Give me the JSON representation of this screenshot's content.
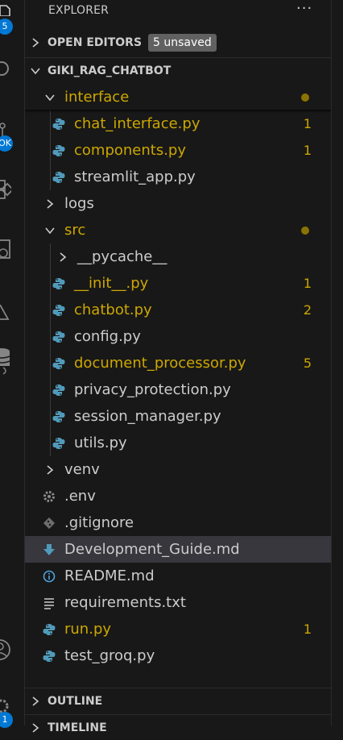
{
  "colors": {
    "modified": "#cca700",
    "normal": "#cccccc",
    "python_icon": "#519aba",
    "badge": "#0078d4",
    "selected_row": "#37373d",
    "md_icon": "#519aba",
    "info_icon": "#4fa3e0"
  },
  "activity_bar": {
    "badges": [
      "5",
      "OK",
      "1"
    ],
    "icons": [
      "files-icon",
      "search-icon",
      "source-control-icon",
      "extensions-icon",
      "remote-explorer-icon",
      "testing-icon",
      "database-icon",
      "account-icon",
      "settings-icon"
    ]
  },
  "explorer": {
    "title": "EXPLORER",
    "more_actions": "···",
    "open_editors": {
      "label": "OPEN EDITORS",
      "badge": "5 unsaved"
    },
    "project": {
      "label": "GIKI_RAG_CHATBOT"
    },
    "tree": [
      {
        "name": "interface",
        "kind": "folder",
        "open": true,
        "indent": 1,
        "status": "modified",
        "dot": true
      },
      {
        "name": "chat_interface.py",
        "kind": "py",
        "indent": 2,
        "status": "modified",
        "count": "1"
      },
      {
        "name": "components.py",
        "kind": "py",
        "indent": 2,
        "status": "modified",
        "count": "1"
      },
      {
        "name": "streamlit_app.py",
        "kind": "py",
        "indent": 2,
        "status": "normal"
      },
      {
        "name": "logs",
        "kind": "folder",
        "open": false,
        "indent": 1,
        "status": "normal"
      },
      {
        "name": "src",
        "kind": "folder",
        "open": true,
        "indent": 1,
        "status": "modified",
        "dot": true
      },
      {
        "name": "__pycache__",
        "kind": "folder",
        "open": false,
        "indent": 2,
        "status": "normal"
      },
      {
        "name": "__init__.py",
        "kind": "py",
        "indent": 2,
        "status": "modified",
        "count": "1"
      },
      {
        "name": "chatbot.py",
        "kind": "py",
        "indent": 2,
        "status": "modified",
        "count": "2"
      },
      {
        "name": "config.py",
        "kind": "py",
        "indent": 2,
        "status": "normal"
      },
      {
        "name": "document_processor.py",
        "kind": "py",
        "indent": 2,
        "status": "modified",
        "count": "5"
      },
      {
        "name": "privacy_protection.py",
        "kind": "py",
        "indent": 2,
        "status": "normal"
      },
      {
        "name": "session_manager.py",
        "kind": "py",
        "indent": 2,
        "status": "normal"
      },
      {
        "name": "utils.py",
        "kind": "py",
        "indent": 2,
        "status": "normal"
      },
      {
        "name": "venv",
        "kind": "folder",
        "open": false,
        "indent": 1,
        "status": "normal"
      },
      {
        "name": ".env",
        "kind": "env",
        "indent": 1,
        "status": "normal"
      },
      {
        "name": ".gitignore",
        "kind": "git",
        "indent": 1,
        "status": "normal"
      },
      {
        "name": "Development_Guide.md",
        "kind": "md",
        "indent": 1,
        "status": "normal",
        "selected": true
      },
      {
        "name": "README.md",
        "kind": "info",
        "indent": 1,
        "status": "normal"
      },
      {
        "name": "requirements.txt",
        "kind": "txt",
        "indent": 1,
        "status": "normal"
      },
      {
        "name": "run.py",
        "kind": "py",
        "indent": 1,
        "status": "modified",
        "count": "1"
      },
      {
        "name": "test_groq.py",
        "kind": "py",
        "indent": 1,
        "status": "normal"
      }
    ],
    "outline": {
      "label": "OUTLINE"
    },
    "timeline": {
      "label": "TIMELINE"
    }
  }
}
